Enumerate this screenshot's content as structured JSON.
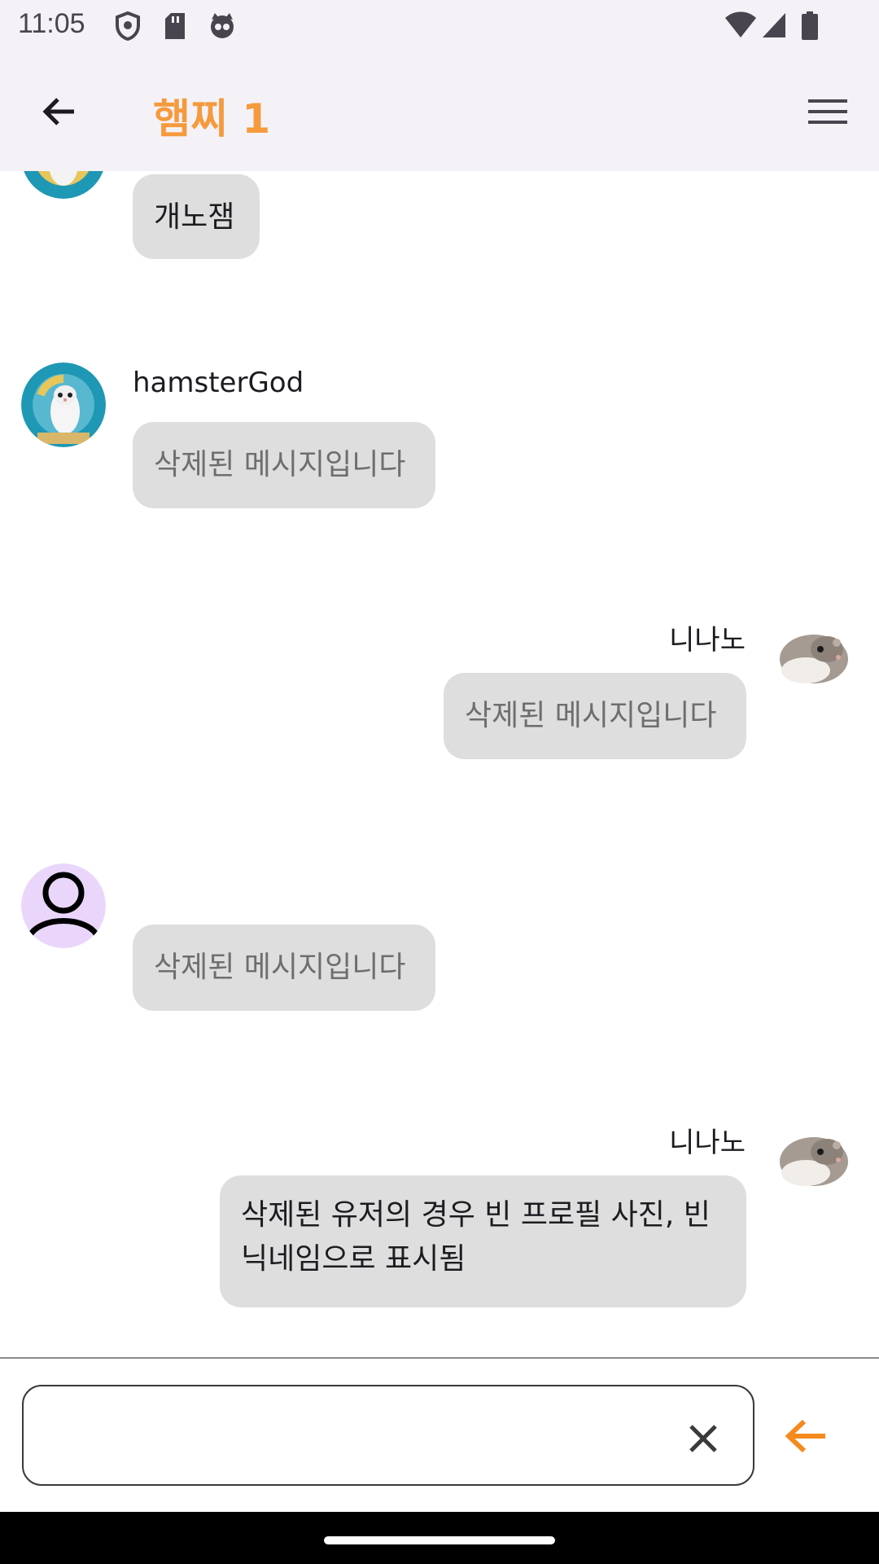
{
  "status_bar": {
    "time": "11:05",
    "icons": [
      "shield-icon",
      "sd-card-icon",
      "cat-icon",
      "wifi-icon",
      "cell-signal-icon",
      "battery-icon"
    ]
  },
  "app_bar": {
    "title": "햄찌 1",
    "title_color": "#f59a3d",
    "back_icon": "arrow-back-icon",
    "menu_icon": "menu-icon"
  },
  "messages": [
    {
      "side": "left",
      "sender": "",
      "text": "개노잼",
      "deleted": false,
      "avatar": "hamster-wheel-avatar"
    },
    {
      "side": "left",
      "sender": "hamsterGod",
      "text": "삭제된 메시지입니다",
      "deleted": true,
      "avatar": "hamster-wheel-avatar"
    },
    {
      "side": "right",
      "sender": "니나노",
      "text": "삭제된 메시지입니다",
      "deleted": true,
      "avatar": "hamster-photo-avatar"
    },
    {
      "side": "left",
      "sender": "",
      "text": "삭제된 메시지입니다",
      "deleted": true,
      "avatar": "default-user-avatar"
    },
    {
      "side": "right",
      "sender": "니나노",
      "text": "삭제된 유저의 경우 빈 프로필 사진, 빈 닉네임으로 표시됨",
      "deleted": false,
      "avatar": "hamster-photo-avatar"
    }
  ],
  "composer": {
    "value": "",
    "placeholder": "",
    "clear_icon": "close-icon",
    "send_icon": "send-arrow-icon",
    "accent": "#f58a1f"
  }
}
